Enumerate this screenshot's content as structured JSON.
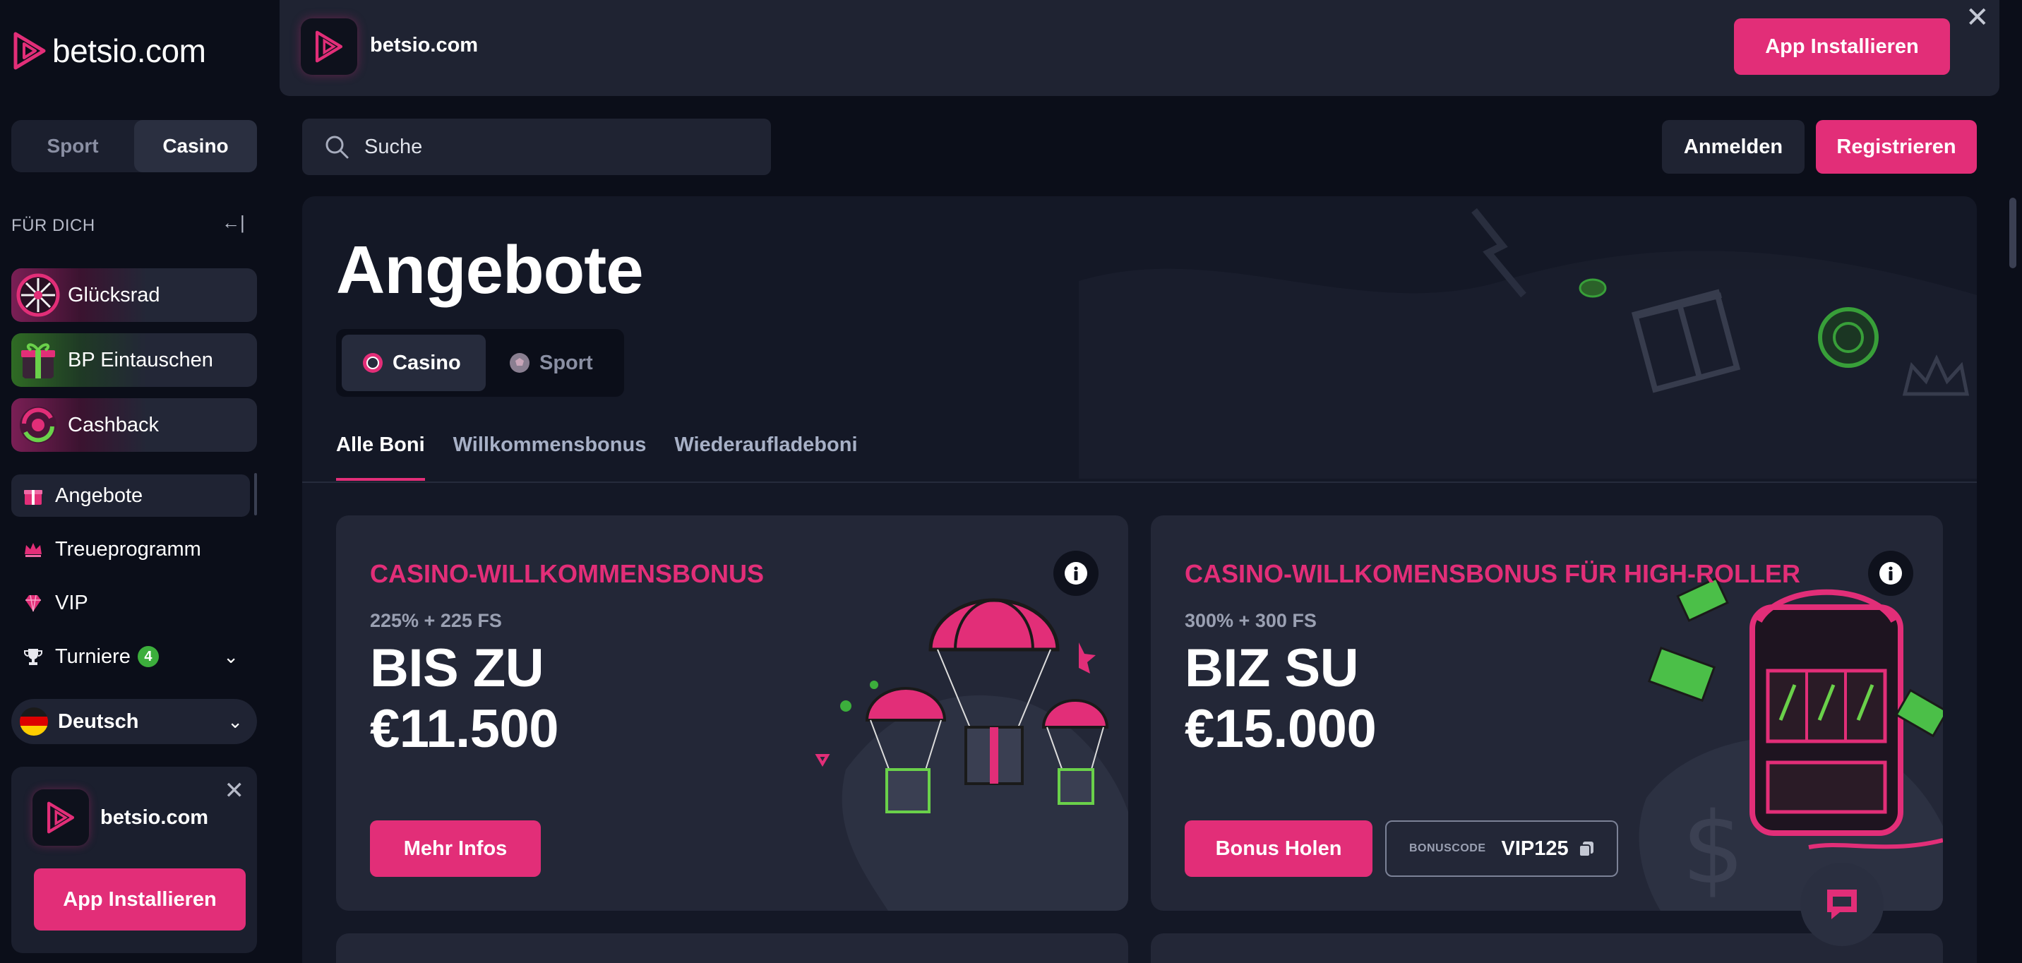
{
  "brand": {
    "name": "betsio.com",
    "accent": "#e22e78",
    "green": "#3cae3c"
  },
  "sidebar": {
    "toggle": {
      "sport": "Sport",
      "casino": "Casino",
      "active": "Casino"
    },
    "section_label": "FÜR DICH",
    "promos": [
      {
        "label": "Glücksrad",
        "icon": "wheel-icon"
      },
      {
        "label": "BP Eintauschen",
        "icon": "gift-box-icon"
      },
      {
        "label": "Cashback",
        "icon": "cashback-icon"
      }
    ],
    "nav": [
      {
        "label": "Angebote",
        "icon": "gift-icon",
        "active": true
      },
      {
        "label": "Treueprogramm",
        "icon": "crown-icon"
      },
      {
        "label": "VIP",
        "icon": "diamond-icon"
      },
      {
        "label": "Turniere",
        "icon": "trophy-icon",
        "badge": "4"
      }
    ],
    "language": "Deutsch",
    "install_card": {
      "name": "betsio.com",
      "button": "App Installieren"
    }
  },
  "top_banner": {
    "name": "betsio.com",
    "button": "App Installieren"
  },
  "header": {
    "search_placeholder": "Suche",
    "login": "Anmelden",
    "register": "Registrieren"
  },
  "main": {
    "title": "Angebote",
    "category_toggle": {
      "casino": "Casino",
      "sport": "Sport",
      "active": "Casino"
    },
    "tabs": [
      "Alle Boni",
      "Willkommensbonus",
      "Wiederaufladeboni"
    ],
    "active_tab": "Alle Boni",
    "cards": [
      {
        "title": "CASINO-WILLKOMMENSBONUS",
        "subtitle": "225% + 225 FS",
        "amount_line1": "BIS ZU",
        "amount_line2": "€11.500",
        "button": "Mehr Infos"
      },
      {
        "title": "CASINO-WILLKOMENSBONUS FÜR HIGH-ROLLER",
        "subtitle": "300% + 300 FS",
        "amount_line1": "BIZ SU",
        "amount_line2": "€15.000",
        "button": "Bonus Holen",
        "code_label": "BONUSCODE",
        "code_value": "VIP125"
      }
    ]
  }
}
